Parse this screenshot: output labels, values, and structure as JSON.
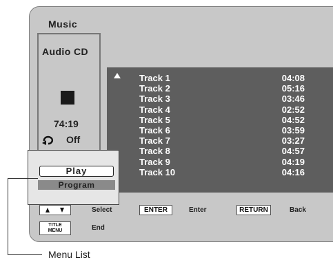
{
  "header": {
    "title": "Music"
  },
  "disc": {
    "type": "Audio CD",
    "total_time": "74:19",
    "repeat_label": "Off"
  },
  "tracks": [
    {
      "name": "Track 1",
      "time": "04:08"
    },
    {
      "name": "Track 2",
      "time": "05:16"
    },
    {
      "name": "Track 3",
      "time": "03:46"
    },
    {
      "name": "Track 4",
      "time": "02:52"
    },
    {
      "name": "Track 5",
      "time": "04:52"
    },
    {
      "name": "Track 6",
      "time": "03:59"
    },
    {
      "name": "Track 7",
      "time": "03:27"
    },
    {
      "name": "Track 8",
      "time": "04:57"
    },
    {
      "name": "Track 9",
      "time": "04:19"
    },
    {
      "name": "Track 10",
      "time": "04:16"
    }
  ],
  "menu": {
    "play_label": "Play",
    "program_label": "Program"
  },
  "guide": {
    "select_label": "Select",
    "enter_key": "ENTER",
    "enter_label": "Enter",
    "return_key": "RETURN",
    "back_label": "Back",
    "title_key_line1": "TITLE",
    "title_key_line2": "MENU",
    "end_label": "End"
  },
  "callout": {
    "label": "Menu List"
  },
  "colors": {
    "screen_bg": "#c8c8c8",
    "track_panel_bg": "#5e5e5e",
    "track_text": "#ffffff"
  }
}
